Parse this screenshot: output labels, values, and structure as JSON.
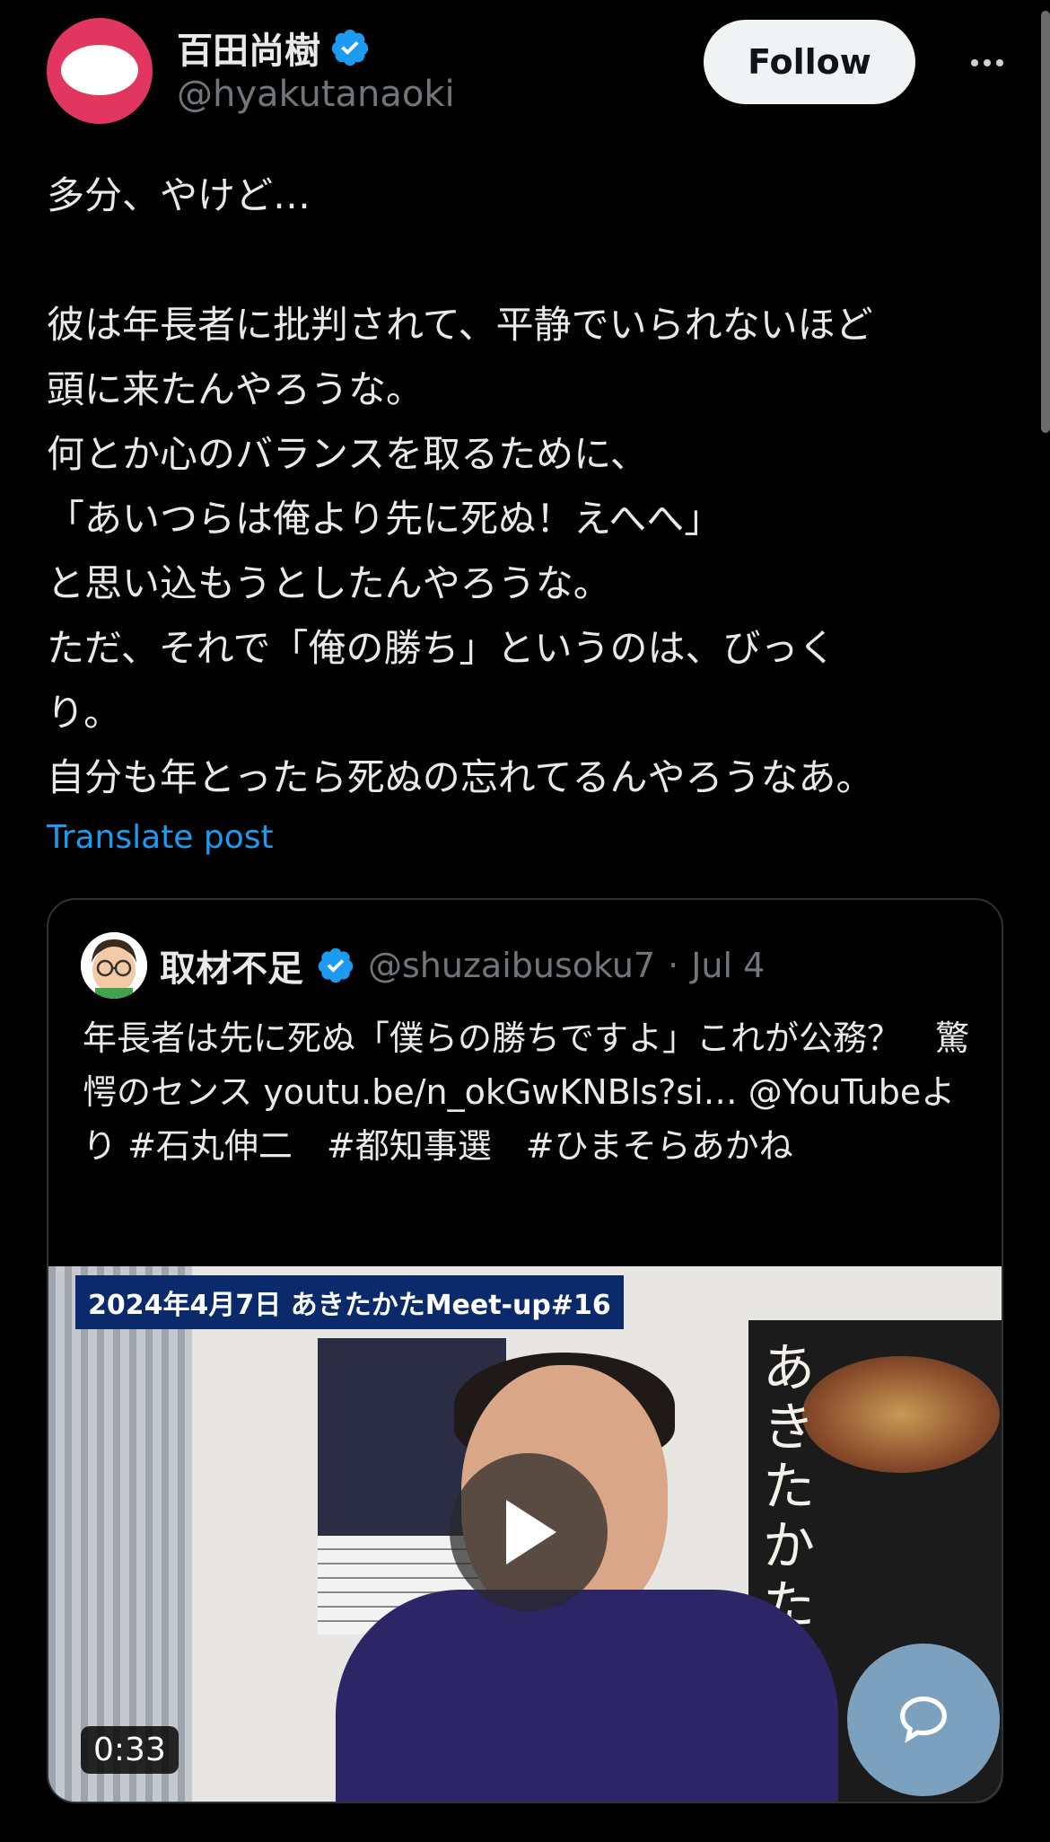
{
  "author": {
    "display_name": "百田尚樹",
    "handle": "@hyakutanaoki",
    "verified": true,
    "avatar_color": "#e0365f"
  },
  "actions": {
    "follow_label": "Follow",
    "more_icon": "more-horizontal-icon"
  },
  "post": {
    "text": "多分、やけど…\n\n彼は年長者に批判されて、平静でいられないほど\n頭に来たんやろうな。\n何とか心のバランスを取るために、\n「あいつらは俺より先に死ぬ！えへへ」\nと思い込もうとしたんやろうな。\nただ、それで「俺の勝ち」というのは、びっく\nり。\n自分も年とったら死ぬの忘れてるんやろうなあ。",
    "translate_label": "Translate post"
  },
  "quoted": {
    "display_name": "取材不足",
    "handle": "@shuzaibusoku7",
    "separator": "·",
    "date": "Jul 4",
    "verified": true,
    "text": "年長者は先に死ぬ「僕らの勝ちですよ」これが公務？　驚愕のセンス youtu.be/n_okGwKNBls?si… @YouTubeより #石丸伸二　#都知事選　#ひまそらあかね",
    "video": {
      "banner_text": "2024年4月7日 あきたかたMeet-up#16",
      "poster_text": "あきたかた焼き始動。",
      "duration": "0:33"
    }
  },
  "colors": {
    "background": "#000000",
    "text": "#e7e9ea",
    "secondary": "#71767b",
    "link": "#1d9bf0",
    "verified": "#1d9bf0"
  }
}
